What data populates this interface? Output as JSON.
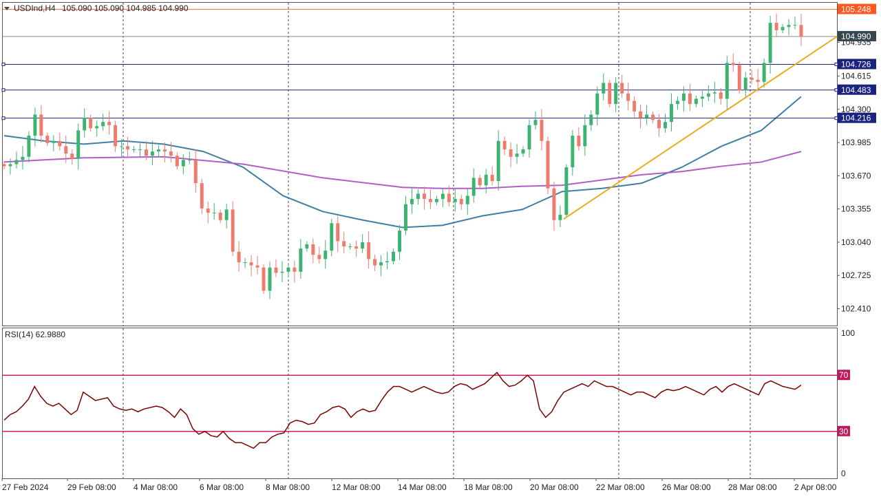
{
  "header": {
    "symbol": "USDInd,H4",
    "ohlc": "105.090 105.090 104.985 104.990",
    "menu_icon": "dropdown-triangle-icon"
  },
  "rsi_header": {
    "label": "RSI(14) 62.9880"
  },
  "colors": {
    "bull": "#26a69a",
    "bull_body": "#3cb371",
    "bear": "#ef7b6c",
    "ma_fast": "#3d7ea6",
    "ma_slow": "#b05ec6",
    "trendline": "#f0a81c",
    "hline": "#1a237e",
    "last_price_line": "#888888",
    "top_line": "#ff6d2d",
    "rsi_line": "#7a0000",
    "rsi_level": "#d81b60",
    "grid_vline": "#333333"
  },
  "price_labels": [
    {
      "value": "105.248",
      "bg": "#ff5722",
      "fg": "#ffffff"
    },
    {
      "value": "104.990",
      "bg": "#37474f",
      "fg": "#ffffff"
    },
    {
      "value": "104.726",
      "bg": "#1a237e",
      "fg": "#ffffff"
    },
    {
      "value": "104.483",
      "bg": "#1a237e",
      "fg": "#ffffff"
    },
    {
      "value": "104.216",
      "bg": "#1a237e",
      "fg": "#ffffff"
    }
  ],
  "rsi_level_labels": [
    {
      "value": "70",
      "bg": "#c2185b",
      "fg": "#ffffff"
    },
    {
      "value": "30",
      "bg": "#c2185b",
      "fg": "#ffffff"
    }
  ],
  "chart_data": [
    {
      "type": "candlestick",
      "title": "USDInd,H4",
      "yticks": [
        "104.935",
        "104.615",
        "104.300",
        "103.985",
        "103.670",
        "103.355",
        "103.040",
        "102.725",
        "102.410"
      ],
      "ylim": [
        102.25,
        105.31
      ],
      "xticks": [
        "27 Feb 2024",
        "29 Feb 08:00",
        "4 Mar 08:00",
        "6 Mar 08:00",
        "8 Mar 08:00",
        "12 Mar 08:00",
        "14 Mar 08:00",
        "18 Mar 08:00",
        "20 Mar 08:00",
        "22 Mar 08:00",
        "26 Mar 08:00",
        "28 Mar 08:00",
        "2 Apr 08:00"
      ],
      "horizontal_levels": [
        105.248,
        104.99,
        104.726,
        104.483,
        104.216
      ],
      "series": [
        {
          "name": "",
          "kind": "ohlc",
          "o": [
            103.78,
            103.76,
            103.78,
            103.82,
            103.85,
            104.05,
            104.25,
            104.05,
            103.98,
            104.0,
            103.95,
            103.88,
            103.83,
            104.1,
            104.22,
            104.12,
            104.14,
            104.18,
            104.15,
            103.95,
            103.95,
            103.92,
            103.92,
            103.92,
            103.86,
            103.9,
            103.92,
            103.9,
            103.86,
            103.76,
            103.82,
            103.82,
            103.6,
            103.36,
            103.32,
            103.32,
            103.25,
            103.35,
            102.95,
            102.85,
            102.85,
            102.82,
            102.8,
            102.58,
            102.8,
            102.75,
            102.76,
            102.8,
            102.76,
            102.98,
            103.02,
            102.92,
            102.88,
            102.96,
            103.22,
            103.05,
            103.0,
            103.0,
            102.98,
            103.04,
            102.88,
            102.82,
            102.85,
            102.86,
            102.95,
            103.15,
            103.4,
            103.45,
            103.5,
            103.45,
            103.42,
            103.45,
            103.5,
            103.42,
            103.45,
            103.4,
            103.48,
            103.65,
            103.58,
            103.68,
            103.62,
            104.0,
            103.92,
            103.85,
            103.88,
            103.92,
            104.15,
            104.2,
            104.0,
            103.55,
            103.25,
            103.3,
            103.75,
            104.05,
            103.95,
            104.15,
            104.25,
            104.45,
            104.55,
            104.35,
            104.55,
            104.45,
            104.38,
            104.28,
            104.22,
            104.25,
            104.2,
            104.12,
            104.18,
            104.35,
            104.38,
            104.45,
            104.35,
            104.4,
            104.42,
            104.45,
            104.46,
            104.4,
            104.74,
            104.72,
            104.48,
            104.6,
            104.58,
            104.56,
            104.74,
            105.12,
            105.05,
            105.08,
            105.1,
            105.1
          ],
          "c": [
            103.76,
            103.78,
            103.82,
            103.85,
            104.05,
            104.25,
            104.05,
            103.98,
            104.0,
            103.95,
            103.88,
            103.83,
            104.1,
            104.22,
            104.12,
            104.14,
            104.18,
            104.15,
            103.95,
            103.95,
            103.92,
            103.92,
            103.92,
            103.86,
            103.9,
            103.92,
            103.9,
            103.86,
            103.76,
            103.82,
            103.82,
            103.6,
            103.36,
            103.32,
            103.32,
            103.25,
            103.35,
            102.95,
            102.85,
            102.85,
            102.82,
            102.8,
            102.58,
            102.8,
            102.75,
            102.76,
            102.8,
            102.76,
            102.98,
            103.02,
            102.92,
            102.88,
            102.96,
            103.22,
            103.05,
            103.0,
            103.0,
            102.98,
            103.04,
            102.88,
            102.82,
            102.85,
            102.86,
            102.95,
            103.15,
            103.4,
            103.45,
            103.5,
            103.45,
            103.42,
            103.45,
            103.5,
            103.42,
            103.45,
            103.4,
            103.48,
            103.65,
            103.58,
            103.68,
            103.62,
            104.0,
            103.92,
            103.85,
            103.88,
            103.92,
            104.15,
            104.2,
            104.0,
            103.55,
            103.25,
            103.3,
            103.75,
            104.05,
            103.95,
            104.15,
            104.25,
            104.45,
            104.55,
            104.35,
            104.55,
            104.45,
            104.38,
            104.28,
            104.22,
            104.25,
            104.2,
            104.12,
            104.18,
            104.35,
            104.38,
            104.45,
            104.35,
            104.4,
            104.42,
            104.45,
            104.46,
            104.4,
            104.74,
            104.72,
            104.48,
            104.6,
            104.58,
            104.56,
            104.74,
            105.12,
            105.05,
            105.08,
            105.1,
            105.1,
            104.99
          ]
        },
        {
          "name": "",
          "kind": "ma",
          "x_frac": [
            0,
            0.05,
            0.1,
            0.15,
            0.2,
            0.25,
            0.3,
            0.35,
            0.4,
            0.45,
            0.5,
            0.55,
            0.6,
            0.65,
            0.7,
            0.75,
            0.8,
            0.85,
            0.9,
            0.95,
            1.0
          ],
          "values": [
            104.05,
            104.0,
            103.97,
            104.0,
            103.97,
            103.9,
            103.75,
            103.48,
            103.33,
            103.25,
            103.18,
            103.2,
            103.29,
            103.35,
            103.52,
            103.55,
            103.6,
            103.75,
            103.95,
            104.1,
            104.42
          ]
        },
        {
          "name": "",
          "kind": "ma",
          "x_frac": [
            0,
            0.1,
            0.2,
            0.3,
            0.4,
            0.5,
            0.55,
            0.6,
            0.65,
            0.7,
            0.75,
            0.8,
            0.85,
            0.9,
            0.95,
            1.0
          ],
          "values": [
            103.8,
            103.84,
            103.85,
            103.78,
            103.65,
            103.56,
            103.55,
            103.55,
            103.57,
            103.58,
            103.63,
            103.68,
            103.71,
            103.76,
            103.8,
            103.9
          ]
        },
        {
          "name": "",
          "kind": "trendline",
          "from": [
            103.26
          ],
          "to": [
            104.99
          ]
        }
      ]
    },
    {
      "type": "line",
      "title": "RSI(14) 62.9880",
      "yticks": [
        "100",
        "70",
        "30",
        "0"
      ],
      "ylim": [
        0,
        100
      ],
      "levels": [
        70,
        30
      ],
      "series": [
        {
          "name": "",
          "values": [
            38,
            42,
            44,
            48,
            53,
            62,
            55,
            50,
            48,
            50,
            46,
            42,
            45,
            58,
            55,
            52,
            53,
            54,
            48,
            46,
            45,
            46,
            44,
            46,
            47,
            48,
            47,
            44,
            40,
            46,
            42,
            32,
            28,
            30,
            27,
            26,
            30,
            25,
            22,
            22,
            20,
            18,
            22,
            22,
            26,
            28,
            29,
            36,
            38,
            37,
            35,
            36,
            42,
            44,
            47,
            48,
            46,
            40,
            44,
            46,
            44,
            45,
            52,
            58,
            62,
            62,
            60,
            58,
            60,
            62,
            60,
            58,
            57,
            58,
            62,
            64,
            63,
            60,
            62,
            64,
            68,
            72,
            66,
            62,
            63,
            66,
            70,
            66,
            46,
            40,
            44,
            52,
            58,
            60,
            62,
            64,
            62,
            66,
            64,
            62,
            62,
            60,
            58,
            56,
            58,
            58,
            56,
            54,
            58,
            60,
            59,
            60,
            62,
            60,
            58,
            56,
            60,
            62,
            58,
            62,
            64,
            62,
            60,
            58,
            56,
            64,
            66,
            64,
            62,
            61,
            60,
            63
          ],
          "last": 62.988
        }
      ]
    }
  ]
}
